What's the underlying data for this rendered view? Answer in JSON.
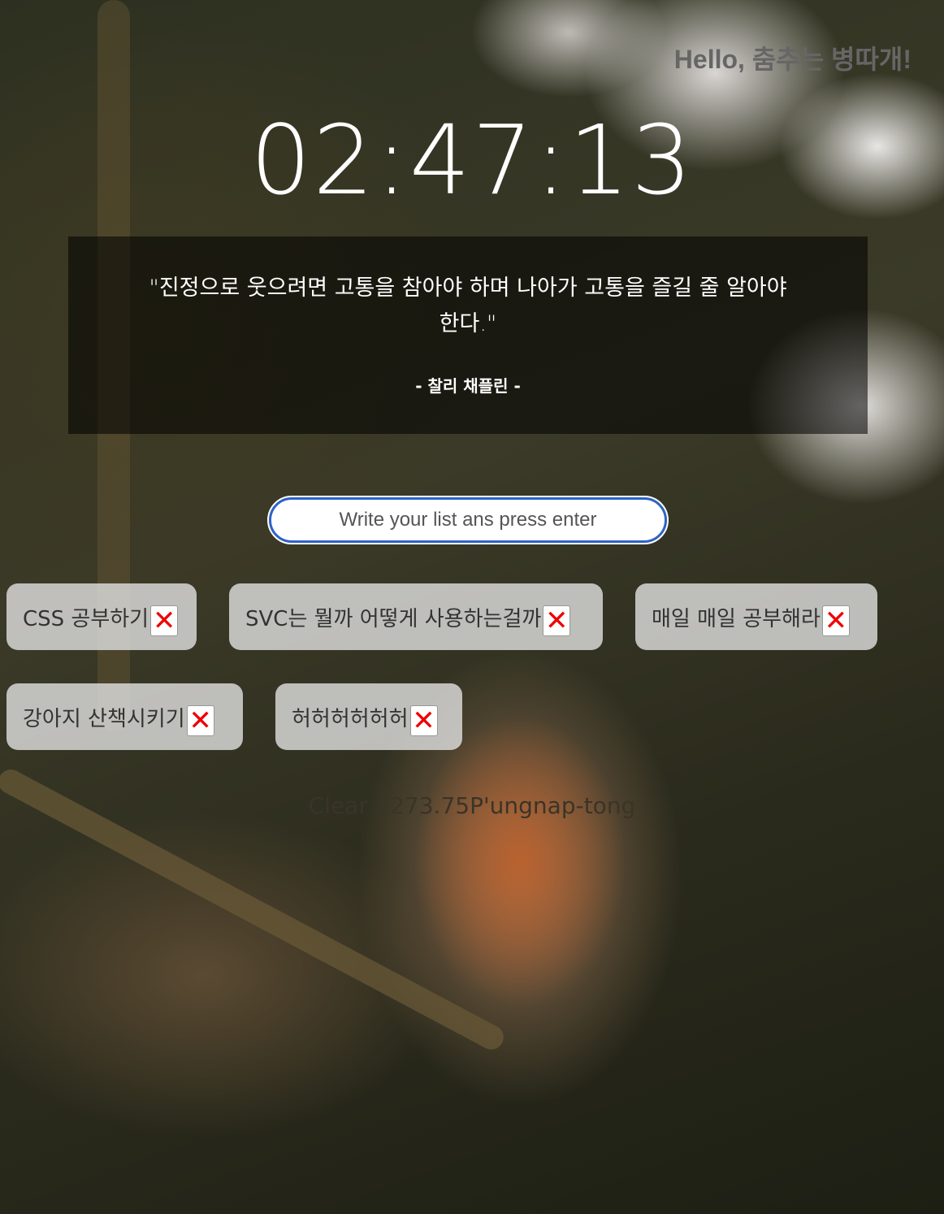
{
  "greeting": "Hello, 춤추는 병따개!",
  "clock": "02:47:13",
  "quote": {
    "text": "\"진정으로 웃으려면 고통을 참아야 하며 나아가 고통을 즐길 줄 알아야 한다.\"",
    "author": "- 찰리 채플린 -"
  },
  "todo_input": {
    "placeholder": "Write your list ans press enter"
  },
  "todos": [
    {
      "label": "CSS 공부하기",
      "delete": "✕"
    },
    {
      "label": "SVC는 뭘까 어떻게 사용하는걸까",
      "delete": "✕"
    },
    {
      "label": "매일 매일 공부해라",
      "delete": "✕"
    },
    {
      "label": "강아지 산책시키기",
      "delete": "✕"
    },
    {
      "label": "허허허허허허",
      "delete": "✕"
    }
  ],
  "weather": "Clear / 273.75P'ungnap-tong"
}
